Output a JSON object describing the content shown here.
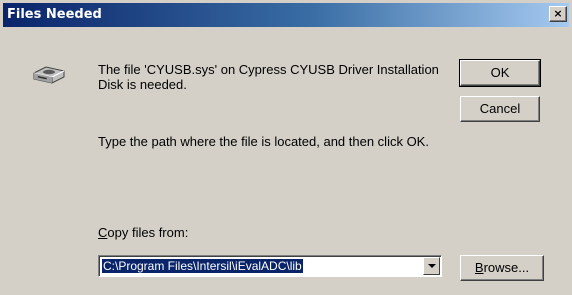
{
  "window": {
    "title": "Files Needed",
    "close_glyph": "×"
  },
  "message": {
    "line1": "The file 'CYUSB.sys' on Cypress CYUSB Driver Installation Disk is needed.",
    "line2": "Type the path where the file is located, and then click OK."
  },
  "icon": {
    "name": "disk-drive-icon"
  },
  "buttons": {
    "ok": "OK",
    "cancel": "Cancel",
    "browse_prefix": "B",
    "browse_rest": "rowse..."
  },
  "copy_from": {
    "label_prefix": "C",
    "label_rest": "opy files from:",
    "value": "C:\\Program Files\\Intersil\\iEvalADC\\lib"
  },
  "colors": {
    "title_start": "#0a246a",
    "title_end": "#a6caf0",
    "face": "#d4d0c8"
  }
}
